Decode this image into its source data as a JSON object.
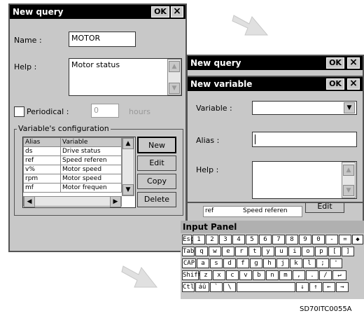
{
  "win1": {
    "title": "New query",
    "ok": "OK",
    "close": "×",
    "name_label": "Name :",
    "name_value": "MOTOR",
    "help_label": "Help :",
    "help_value": "Motor status",
    "periodical_label": "Periodical :",
    "periodical_value": "0",
    "periodical_unit": "hours",
    "group_label": "Variable's configuration",
    "table_headers": [
      "Alias",
      "Variable"
    ],
    "rows": [
      [
        "ds",
        "Drive status"
      ],
      [
        "ref",
        "Speed referen"
      ],
      [
        "v%",
        "Motor speed"
      ],
      [
        "rpm",
        "Motor speed"
      ],
      [
        "mf",
        "Motor frequen"
      ]
    ],
    "buttons": [
      "New",
      "Edit",
      "Copy",
      "Delete"
    ]
  },
  "win2": {
    "title": "New query",
    "ok": "OK",
    "close": "×",
    "under_row": [
      "ref",
      "Speed referen"
    ],
    "under_button": "Edit"
  },
  "win3": {
    "title": "New variable",
    "ok": "OK",
    "close": "×",
    "variable_label": "Variable :",
    "alias_label": "Alias :",
    "help_label": "Help :"
  },
  "input_panel": {
    "title": "Input Panel",
    "rows": [
      [
        "Esc",
        "1",
        "2",
        "3",
        "4",
        "5",
        "6",
        "7",
        "8",
        "9",
        "0",
        "-",
        "=",
        "◆"
      ],
      [
        "Tab",
        "q",
        "w",
        "e",
        "r",
        "t",
        "y",
        "u",
        "i",
        "o",
        "p",
        "[",
        "]"
      ],
      [
        "CAP",
        "a",
        "s",
        "d",
        "f",
        "g",
        "h",
        "j",
        "k",
        "l",
        ";",
        "'"
      ],
      [
        "Shift",
        "z",
        "x",
        "c",
        "v",
        "b",
        "n",
        "m",
        ",",
        ".",
        "/",
        "↵"
      ],
      [
        "Ctl",
        "áü",
        "`",
        "\\",
        "",
        "↓",
        "↑",
        "←",
        "→"
      ]
    ]
  },
  "figure_code": "SD70ITC0055A"
}
